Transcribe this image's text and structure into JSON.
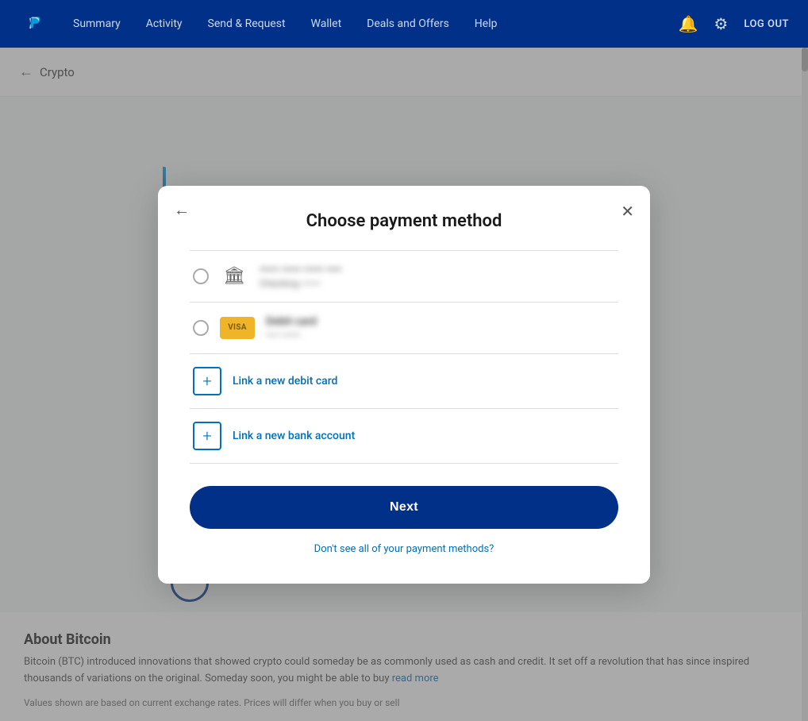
{
  "navbar": {
    "logo_alt": "PayPal",
    "links": [
      {
        "label": "Summary",
        "id": "summary"
      },
      {
        "label": "Activity",
        "id": "activity"
      },
      {
        "label": "Send & Request",
        "id": "send-request"
      },
      {
        "label": "Wallet",
        "id": "wallet"
      },
      {
        "label": "Deals and Offers",
        "id": "deals"
      },
      {
        "label": "Help",
        "id": "help"
      }
    ],
    "logout_label": "LOG OUT"
  },
  "breadcrumb": {
    "back_label": "←",
    "title": "Crypto"
  },
  "modal": {
    "title": "Choose payment method",
    "back_label": "←",
    "close_label": "✕",
    "payment_options": [
      {
        "type": "bank",
        "name": "••••• ••••• ••••• ••••",
        "detail": "Checking ••••••",
        "selected": false
      },
      {
        "type": "card",
        "name": "Debit card",
        "detail": "•••• ••••••",
        "selected": false
      }
    ],
    "add_debit_label": "Link a new debit card",
    "add_bank_label": "Link a new bank account",
    "next_label": "Next",
    "dont_see_label": "Don't see all of your payment methods?"
  },
  "about": {
    "title": "About Bitcoin",
    "text": "Bitcoin (BTC) introduced innovations that showed crypto could someday be as commonly used as cash and credit. It set off a revolution that has since inspired thousands of variations on the original. Someday soon, you might be able to buy",
    "read_more": "read more",
    "footer": "Values shown are based on current exchange rates. Prices will differ when you buy or sell"
  }
}
